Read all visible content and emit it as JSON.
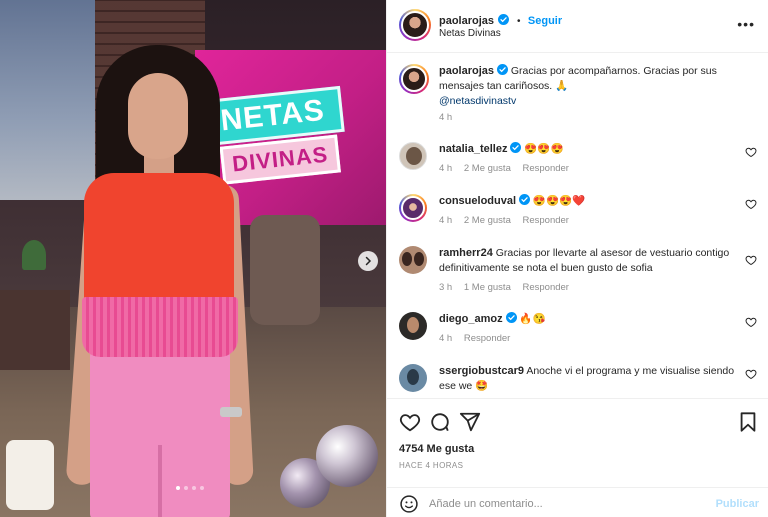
{
  "photo": {
    "logo_top": "NETAS",
    "logo_bottom": "DIVINAS",
    "carousel_dots": 4,
    "active_dot": 1
  },
  "header": {
    "username": "paolarojas",
    "follow_label": "Seguir",
    "subtitle": "Netas Divinas",
    "separator": "•",
    "more_icon": "more-options-icon"
  },
  "caption": {
    "username": "paolarojas",
    "text": "Gracias por acompañarnos. Gracias por sus mensajes tan cariñosos. 🙏",
    "mention": "@netasdivinastv",
    "time": "4 h"
  },
  "comments": [
    {
      "username": "natalia_tellez",
      "verified": true,
      "text": "😍😍😍",
      "time": "4 h",
      "likes": "2 Me gusta",
      "reply": "Responder"
    },
    {
      "username": "consueloduval",
      "verified": true,
      "text": "😍😍😍❤️",
      "time": "4 h",
      "likes": "2 Me gusta",
      "reply": "Responder"
    },
    {
      "username": "ramherr24",
      "verified": false,
      "text": "Gracias por llevarte al asesor de vestuario contigo definitivamente se nota el buen gusto de sofia",
      "time": "3 h",
      "likes": "1 Me gusta",
      "reply": "Responder"
    },
    {
      "username": "diego_amoz",
      "verified": true,
      "text": "🔥😘",
      "time": "4 h",
      "likes": "",
      "reply": "Responder"
    },
    {
      "username": "ssergiobustcar9",
      "verified": false,
      "text": "Anoche vi el programa y me visualise siendo ese we 🤩",
      "time": "",
      "likes": "",
      "reply": ""
    }
  ],
  "actions": {
    "likes": "4754 Me gusta",
    "time_ago": "HACE 4 HORAS",
    "comment_placeholder": "Añade un comentario...",
    "post_label": "Publicar"
  },
  "colors": {
    "accent": "#0095f6",
    "muted": "#8e8e8e",
    "text": "#262626",
    "post_disabled": "#b2dffc"
  }
}
